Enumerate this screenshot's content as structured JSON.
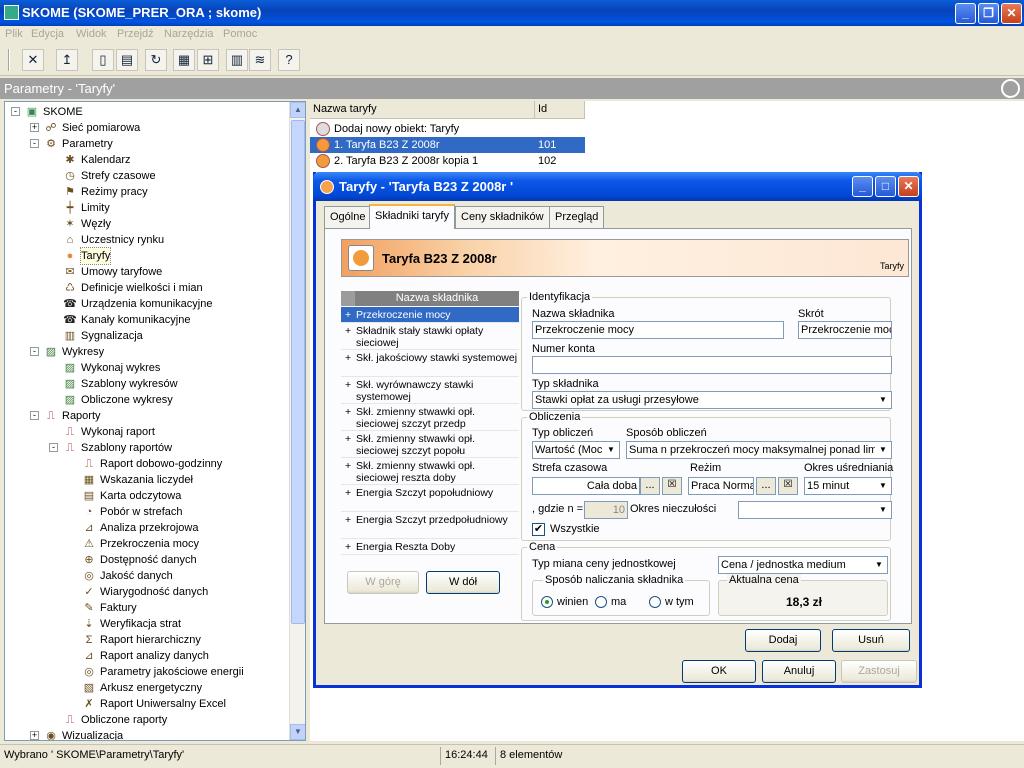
{
  "window": {
    "title": "SKOME (SKOME_PRER_ORA ; skome)"
  },
  "menu": [
    "Plik",
    "Edycja",
    "Widok",
    "Przejdź",
    "Narzędzia",
    "Pomoc"
  ],
  "panel": {
    "title": "Parametry - 'Taryfy'"
  },
  "tree": [
    {
      "label": "SKOME",
      "level": 0,
      "expander": "-",
      "icon": "app-icon"
    },
    {
      "label": "Sieć pomiarowa",
      "level": 1,
      "expander": "+",
      "icon": "network-icon"
    },
    {
      "label": "Parametry",
      "level": 1,
      "expander": "-",
      "icon": "parameters-icon"
    },
    {
      "label": "Kalendarz",
      "level": 2,
      "icon": "calendar-icon"
    },
    {
      "label": "Strefy czasowe",
      "level": 2,
      "icon": "clock-icon"
    },
    {
      "label": "Reżimy pracy",
      "level": 2,
      "icon": "regime-icon"
    },
    {
      "label": "Limity",
      "level": 2,
      "icon": "limit-icon"
    },
    {
      "label": "Węzły",
      "level": 2,
      "icon": "node-icon"
    },
    {
      "label": "Uczestnicy rynku",
      "level": 2,
      "icon": "market-icon"
    },
    {
      "label": "Taryfy",
      "level": 2,
      "icon": "tariff-icon",
      "selected": true
    },
    {
      "label": "Umowy taryfowe",
      "level": 2,
      "icon": "contract-icon"
    },
    {
      "label": "Definicje wielkości i mian",
      "level": 2,
      "icon": "definition-icon"
    },
    {
      "label": "Urządzenia komunikacyjne",
      "level": 2,
      "icon": "phone-icon"
    },
    {
      "label": "Kanały komunikacyjne",
      "level": 2,
      "icon": "phone-icon"
    },
    {
      "label": "Sygnalizacja",
      "level": 2,
      "icon": "signal-icon"
    },
    {
      "label": "Wykresy",
      "level": 1,
      "expander": "-",
      "icon": "chart-icon"
    },
    {
      "label": "Wykonaj wykres",
      "level": 2,
      "icon": "chart-icon"
    },
    {
      "label": "Szablony wykresów",
      "level": 2,
      "icon": "chart-icon"
    },
    {
      "label": "Obliczone wykresy",
      "level": 2,
      "icon": "chart-icon"
    },
    {
      "label": "Raporty",
      "level": 1,
      "expander": "-",
      "icon": "report-icon"
    },
    {
      "label": "Wykonaj raport",
      "level": 2,
      "icon": "report-icon"
    },
    {
      "label": "Szablony raportów",
      "level": 2,
      "expander": "-",
      "icon": "report-icon"
    },
    {
      "label": "Raport dobowo-godzinny",
      "level": 3,
      "icon": "report-icon"
    },
    {
      "label": "Wskazania liczydeł",
      "level": 3,
      "icon": "counter-icon"
    },
    {
      "label": "Karta odczytowa",
      "level": 3,
      "icon": "card-icon"
    },
    {
      "label": "Pobór w strefach",
      "level": 3,
      "icon": "zone-icon"
    },
    {
      "label": "Analiza przekrojowa",
      "level": 3,
      "icon": "analysis-icon"
    },
    {
      "label": "Przekroczenia mocy",
      "level": 3,
      "icon": "exceed-icon"
    },
    {
      "label": "Dostępność danych",
      "level": 3,
      "icon": "data-icon"
    },
    {
      "label": "Jakość danych",
      "level": 3,
      "icon": "quality-icon"
    },
    {
      "label": "Wiarygodność danych",
      "level": 3,
      "icon": "reliability-icon"
    },
    {
      "label": "Faktury",
      "level": 3,
      "icon": "invoice-icon"
    },
    {
      "label": "Weryfikacja strat",
      "level": 3,
      "icon": "loss-icon"
    },
    {
      "label": "Raport hierarchiczny",
      "level": 3,
      "icon": "hierarchy-icon"
    },
    {
      "label": "Raport analizy danych",
      "level": 3,
      "icon": "analysis-icon"
    },
    {
      "label": "Parametry jakościowe energii",
      "level": 3,
      "icon": "quality-icon"
    },
    {
      "label": "Arkusz energetyczny",
      "level": 3,
      "icon": "sheet-icon"
    },
    {
      "label": "Raport Uniwersalny Excel",
      "level": 3,
      "icon": "excel-icon"
    },
    {
      "label": "Obliczone raporty",
      "level": 2,
      "icon": "report-icon"
    },
    {
      "label": "Wizualizacja",
      "level": 1,
      "expander": "+",
      "icon": "visual-icon"
    }
  ],
  "list": {
    "columns": [
      "Nazwa taryfy",
      "Id"
    ],
    "rows": [
      {
        "name": "Dodaj nowy obiekt: Taryfy",
        "id": ""
      },
      {
        "name": "1. Taryfa  B23 Z  2008r",
        "id": "101",
        "selected": true
      },
      {
        "name": "2. Taryfa  B23 Z  2008r  kopia 1",
        "id": "102"
      }
    ]
  },
  "status": {
    "path": "Wybrano ' SKOME\\Parametry\\Taryfy'",
    "time": "16:24:44",
    "count": "8 elementów"
  },
  "dialog": {
    "title": "Taryfy - 'Taryfa  B23 Z  2008r '",
    "tabs": [
      "Ogólne",
      "Składniki taryfy",
      "Ceny składników",
      "Przegląd"
    ],
    "active_tab": 1,
    "banner_title": "Taryfa  B23 Z  2008r",
    "banner_sub": "Taryfy",
    "components_header": "Nazwa składnika",
    "components": [
      "Przekroczenie mocy",
      "Składnik stały stawki opłaty sieciowej",
      "Skł. jakościowy stawki systemowej",
      "Skł. wyrównawczy stawki systemowej",
      "Skł. zmienny  stwawki opł. sieciowej szczyt przedp",
      "Skł. zmienny  stwawki opł. sieciowej szczyt popołu",
      "Skł. zmienny  stwawki opł. sieciowej  reszta doby",
      "Energia Szczyt popołudniowy",
      "Energia Szczyt przedpołudniowy",
      "Energia Reszta Doby"
    ],
    "btn_up": "W górę",
    "btn_down": "W dół",
    "ident": {
      "group": "Identyfikacja",
      "name_label": "Nazwa składnika",
      "name_value": "Przekroczenie mocy",
      "short_label": "Skrót",
      "short_value": "Przekroczenie mocy",
      "account_label": "Numer konta",
      "account_value": "",
      "type_label": "Typ składnika",
      "type_value": "Stawki opłat za usługi przesyłowe"
    },
    "calc": {
      "group": "Obliczenia",
      "calc_type_label": "Typ obliczeń",
      "calc_type_value": "Wartość (Moc",
      "method_label": "Sposób obliczeń",
      "method_value": "Suma n przekroczeń mocy maksymalnej ponad limit",
      "zone_label": "Strefa czasowa",
      "zone_value": "Cała doba",
      "regime_label": "Reżim",
      "regime_value": "Praca Normalna",
      "avg_label": "Okres uśredniania",
      "avg_value": "15 minut",
      "n_label": ", gdzie n =",
      "n_value": "10",
      "imprecision_label": "Okres nieczułości",
      "imprecision_value": "",
      "all_label": "Wszystkie",
      "all_checked": true
    },
    "price": {
      "group": "Cena",
      "unit_label": "Typ miana ceny jednostkowej",
      "unit_value": "Cena / jednostka medium",
      "charge_group": "Sposób naliczania składnika",
      "options": [
        "winien",
        "ma",
        "w tym"
      ],
      "current_group": "Aktualna cena",
      "current_value": "18,3 zł"
    },
    "btn_add": "Dodaj",
    "btn_remove": "Usuń",
    "btn_ok": "OK",
    "btn_cancel": "Anuluj",
    "btn_apply": "Zastosuj"
  }
}
